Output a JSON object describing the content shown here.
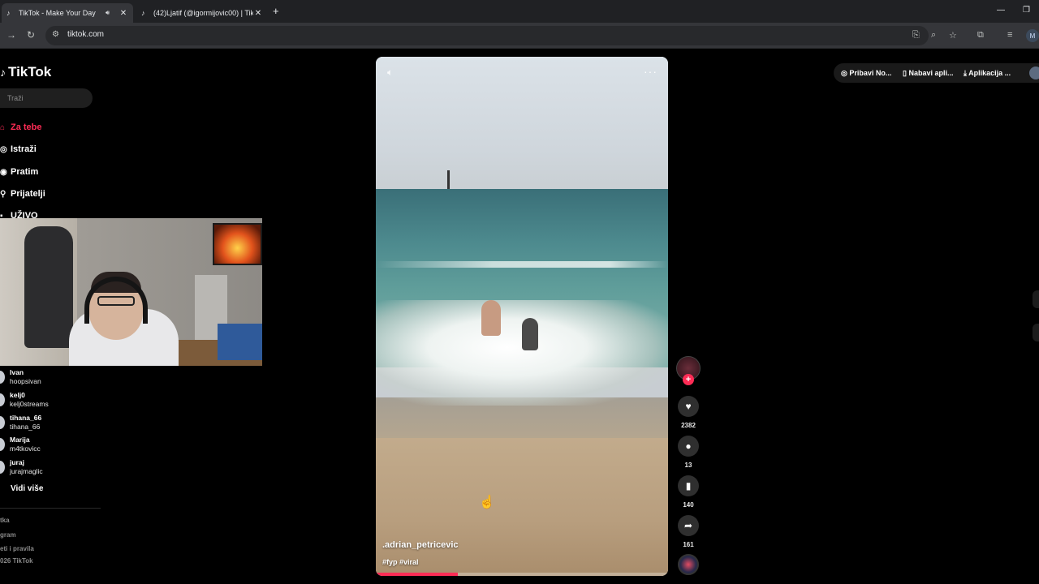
{
  "browser": {
    "tabs": [
      {
        "title": "TikTok - Make Your Day",
        "active": true
      },
      {
        "title": "(42)Ljatif (@igormijovic00) | Tik",
        "active": false
      }
    ],
    "url": "tiktok.com",
    "profile_initial": "M"
  },
  "tiktok": {
    "logo": "TikTok",
    "search_placeholder": "Traži",
    "nav": [
      {
        "label": "Za tebe",
        "icon": "home-icon",
        "active": true
      },
      {
        "label": "Istraži",
        "icon": "compass-icon"
      },
      {
        "label": "Pratim",
        "icon": "following-icon"
      },
      {
        "label": "Prijatelji",
        "icon": "friends-icon"
      },
      {
        "label": "UŽIVO",
        "icon": "live-icon"
      }
    ],
    "following": [
      {
        "name": "Ivan",
        "handle": "hoopsivan"
      },
      {
        "name": "kelj0",
        "handle": "kelj0streams"
      },
      {
        "name": "tihana_66",
        "handle": "tihana_66"
      },
      {
        "name": "Marija",
        "handle": "m4tkovicc"
      },
      {
        "name": "juraj",
        "handle": "jurajmaglic"
      }
    ],
    "see_more": "Vidi više",
    "footer": [
      "tka",
      "gram",
      "eti i pravila",
      "026 TikTok"
    ],
    "top_right": {
      "get_coins": "Pribavi No...",
      "get_app": "Nabavi apli...",
      "desktop_app": "Aplikacija ..."
    }
  },
  "video": {
    "author": ".adrian_petricevic",
    "caption": "#fyp #viral",
    "progress": 0.28,
    "likes": "2382",
    "comments": "13",
    "saves": "140",
    "shares": "161"
  },
  "colors": {
    "accent": "#fe2c55",
    "background": "#000000"
  }
}
